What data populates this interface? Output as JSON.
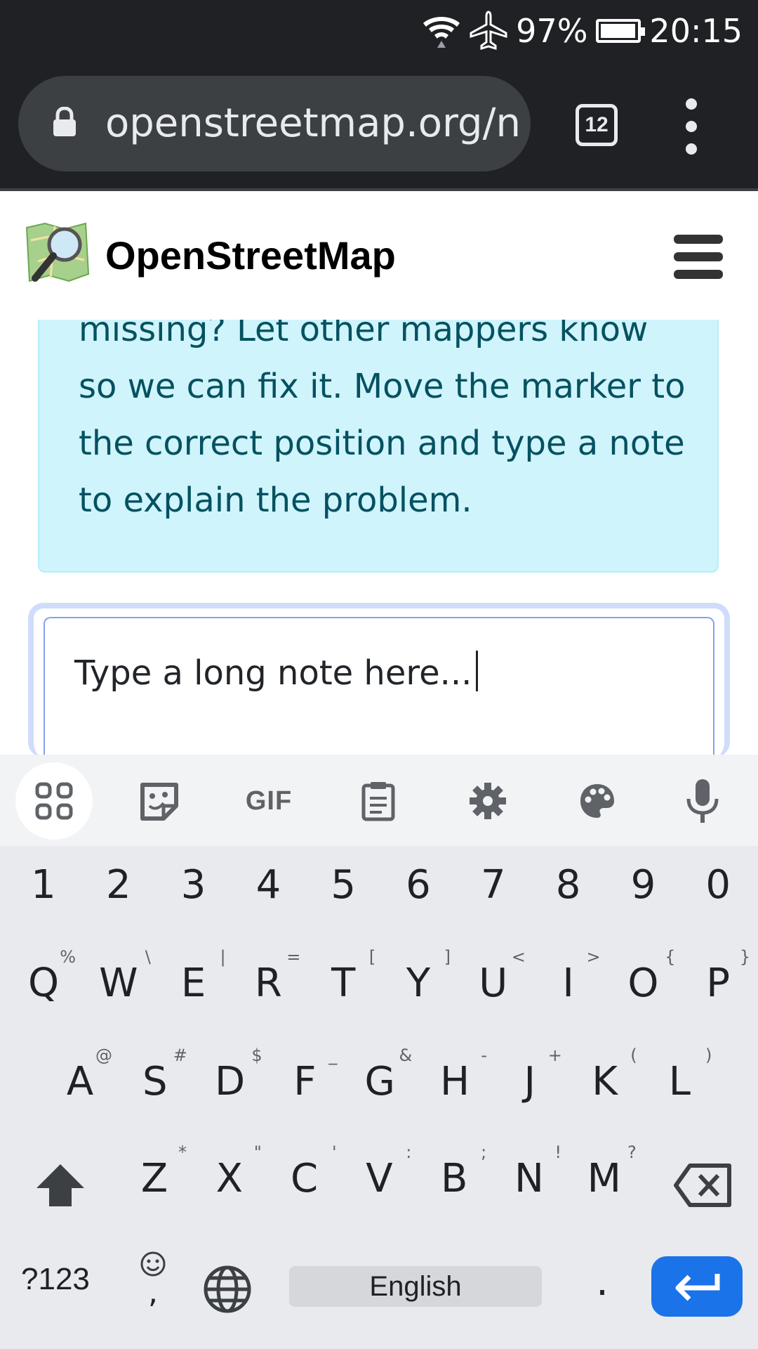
{
  "status_bar": {
    "battery_percent": "97%",
    "battery_level": 0.97,
    "time": "20:15"
  },
  "browser": {
    "url": "openstreetmap.org/n",
    "tab_count": "12"
  },
  "site": {
    "name": "OpenStreetMap"
  },
  "info_box": {
    "text": "missing? Let other mappers know so we can fix it. Move the marker to the correct position and type a note to explain the problem."
  },
  "note_input": {
    "value": "Type a long note here..."
  },
  "keyboard": {
    "toolbar": [
      "apps-grid-icon",
      "sticker-icon",
      "GIF",
      "clipboard-icon",
      "settings-gear-icon",
      "palette-icon",
      "microphone-icon"
    ],
    "gif_label": "GIF",
    "number_row": [
      "1",
      "2",
      "3",
      "4",
      "5",
      "6",
      "7",
      "8",
      "9",
      "0"
    ],
    "row1": [
      {
        "key": "Q",
        "hint": "%"
      },
      {
        "key": "W",
        "hint": "\\"
      },
      {
        "key": "E",
        "hint": "|"
      },
      {
        "key": "R",
        "hint": "="
      },
      {
        "key": "T",
        "hint": "["
      },
      {
        "key": "Y",
        "hint": "]"
      },
      {
        "key": "U",
        "hint": "<"
      },
      {
        "key": "I",
        "hint": ">"
      },
      {
        "key": "O",
        "hint": "{"
      },
      {
        "key": "P",
        "hint": "}"
      }
    ],
    "row2": [
      {
        "key": "A",
        "hint": "@"
      },
      {
        "key": "S",
        "hint": "#"
      },
      {
        "key": "D",
        "hint": "$"
      },
      {
        "key": "F",
        "hint": "_"
      },
      {
        "key": "G",
        "hint": "&"
      },
      {
        "key": "H",
        "hint": "-"
      },
      {
        "key": "J",
        "hint": "+"
      },
      {
        "key": "K",
        "hint": "("
      },
      {
        "key": "L",
        "hint": ")"
      }
    ],
    "row3": [
      {
        "key": "Z",
        "hint": "*"
      },
      {
        "key": "X",
        "hint": "\""
      },
      {
        "key": "C",
        "hint": "'"
      },
      {
        "key": "V",
        "hint": ":"
      },
      {
        "key": "B",
        "hint": ";"
      },
      {
        "key": "N",
        "hint": "!"
      },
      {
        "key": "M",
        "hint": "?"
      }
    ],
    "symbols_label": "?123",
    "comma_label": ",",
    "space_label": "English",
    "period_label": "."
  }
}
